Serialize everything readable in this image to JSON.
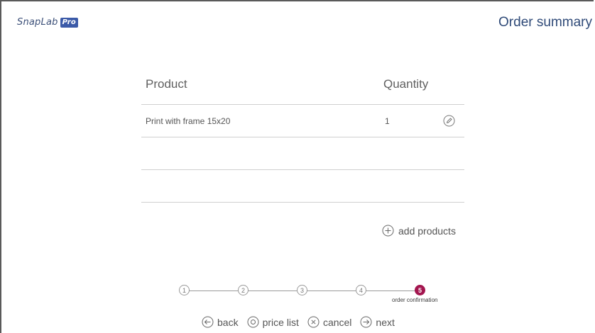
{
  "header": {
    "logo_text": "SnapLab",
    "logo_badge": "Pro",
    "title": "Order summary"
  },
  "table": {
    "columns": [
      "Product",
      "Quantity"
    ],
    "rows": [
      {
        "product": "Print with frame 15x20",
        "quantity": "1"
      }
    ]
  },
  "actions": {
    "add_products_label": "add products"
  },
  "stepper": {
    "steps": [
      "1",
      "2",
      "3",
      "4",
      "5"
    ],
    "active_step": 5,
    "active_label": "order confirmation"
  },
  "nav": {
    "back": "back",
    "price_list": "price list",
    "cancel": "cancel",
    "next": "next"
  },
  "colors": {
    "title": "#2f4a78",
    "active_step": "#a3164f",
    "badge": "#3b5aa8"
  }
}
